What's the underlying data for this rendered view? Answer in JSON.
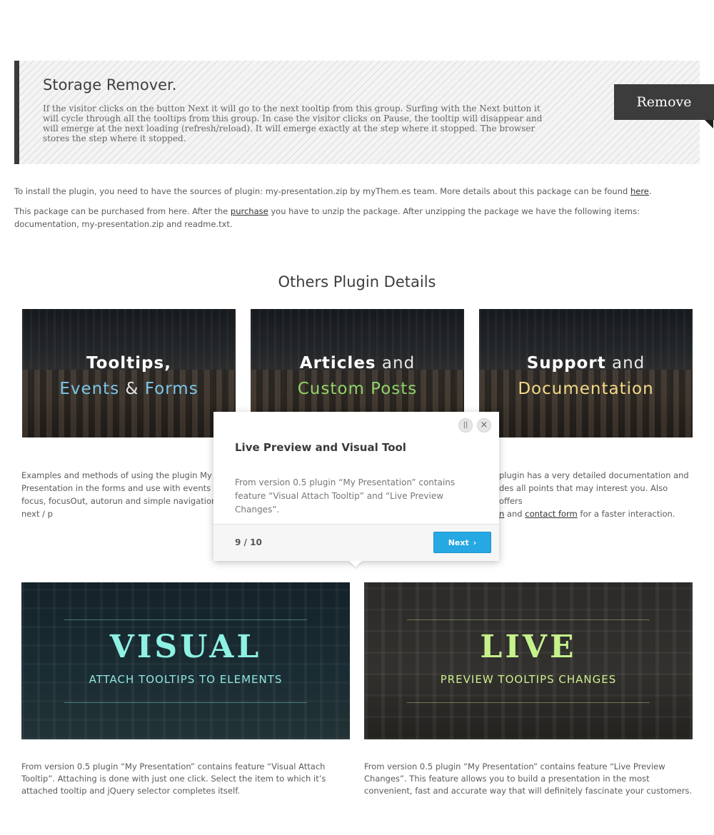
{
  "storage": {
    "title": "Storage Remover.",
    "text": "If the visitor clicks on the button Next it will go to the next tooltip from this group. Surfing with the Next button it will cycle through all the tooltips from this group. In case the visitor clicks on Pause, the tooltip will disappear and will emerge at the next loading (refresh/reload). It will emerge exactly at the step where it stopped. The browser stores the step where it stopped.",
    "remove_label": "Remove"
  },
  "install": {
    "p1_text": "To install the plugin, you need to have the sources of plugin: my-presentation.zip by myThem.es team. More details about this package can be found ",
    "p1_link": "here",
    "p1_end": ".",
    "p2_text": "This package can be purchased from here. After the ",
    "p2_link": "purchase",
    "p2_end": " you have to unzip the package. After unzipping the package we have the following items: documentation, my-presentation.zip and readme.txt."
  },
  "section_title": "Others Plugin Details",
  "tiles": [
    {
      "line1_a": "Tooltips,",
      "line2_a": "Events",
      "line2_amp": "&",
      "line2_b": "Forms"
    },
    {
      "line1_a": "Articles",
      "line1_b": "and",
      "line2_a": "Custom Posts"
    },
    {
      "line1_a": "Support",
      "line1_b": "and",
      "line2_a": "Documentation"
    }
  ],
  "descs": {
    "d1": "Examples and methods of using the plugin My Presentation in the forms and use with events focus, focusOut, autorun and simple navigation ( next / p",
    "d3_a": "plugin has a very detailed documentation and",
    "d3_b": "des all points that may interest you. Also offers",
    "d3_c_link1": "n",
    "d3_c_and": " and ",
    "d3_c_link2": "contact form",
    "d3_c_end": " for a faster interaction."
  },
  "popup": {
    "pause_icon": "||",
    "close_icon": "×",
    "title": "Live Preview and Visual Tool",
    "body": "From version 0.5 plugin “My Presentation” contains feature “Visual Attach Tooltip” and “Live Preview Changes”.",
    "counter": "9 / 10",
    "next_label": "Next",
    "next_chevron": "›"
  },
  "features": {
    "visual_big": "VISUAL",
    "visual_sub": "ATTACH TOOLTIPS TO ELEMENTS",
    "live_big": "LIVE",
    "live_sub": "PREVIEW TOOLTIPS CHANGES",
    "visual_desc": "From version 0.5 plugin “My Presentation” contains feature “Visual Attach Tooltip”. Attaching is done with just one click. Select the item to which it’s attached tooltip and jQuery selector completes itself.",
    "live_desc": "From version 0.5 plugin “My Presentation” contains feature “Live Preview Changes”. This feature allows you to build a presentation in the most convenient, fast and accurate way that will definitely fascinate your customers."
  }
}
